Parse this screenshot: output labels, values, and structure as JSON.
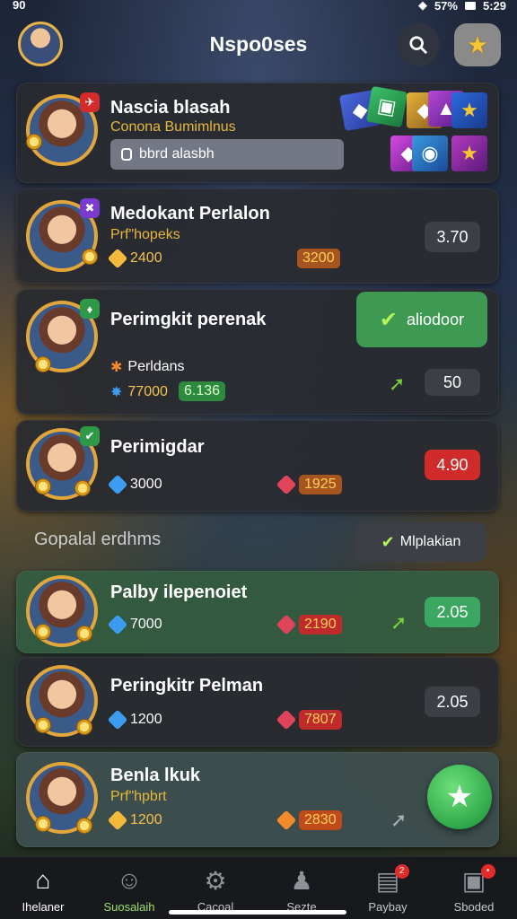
{
  "status": {
    "left": "90",
    "battery": "57%",
    "time": "5:29"
  },
  "header": {
    "title": "Nspo0ses",
    "search_icon": "search-icon",
    "star_icon": "star-icon",
    "star_glyph": "★"
  },
  "profile": {
    "name": "Nascia blasah",
    "subtitle": "Conona Bumimlnus",
    "field_value": "bbrd alasbh",
    "badge": "✈"
  },
  "cards": [
    {
      "name": "Medokant Perlalon",
      "sub": "Prf\"hopeks",
      "stat1": "2400",
      "stat2": "3200",
      "price": "3.70",
      "badge": "✖"
    },
    {
      "name": "Perimgkit perenak",
      "sub": "Perldans",
      "stat1": "77000",
      "stat2": "6.136",
      "price": "50",
      "action": "aliodoor",
      "badge": "♦"
    },
    {
      "name": "Perimigdar",
      "stat1": "3000",
      "stat2": "1925",
      "price": "4.90",
      "badge": "✔"
    },
    {
      "name": "Palby ilepenoiet",
      "stat1": "7000",
      "stat2": "2190",
      "price": "2.05"
    },
    {
      "name": "Peringkitr Pelman",
      "stat1": "1200",
      "stat2": "7807",
      "price": "2.05"
    },
    {
      "name": "Benla lkuk",
      "sub": "Prf\"hpbrt",
      "stat1": "1200",
      "stat2": "2830"
    }
  ],
  "section": {
    "label": "Gopalal erdhms",
    "button": "Mlplakian"
  },
  "nav": [
    {
      "label": "Ihelaner",
      "icon": "home-icon",
      "glyph": "⌂"
    },
    {
      "label": "Suosalaih",
      "icon": "group-icon",
      "glyph": "☺"
    },
    {
      "label": "Cacoal",
      "icon": "gear-icon",
      "glyph": "⚙"
    },
    {
      "label": "Sezte",
      "icon": "people-icon",
      "glyph": "♟"
    },
    {
      "label": "Paybay",
      "icon": "card-icon",
      "glyph": "▤",
      "badge": "2"
    },
    {
      "label": "Sboded",
      "icon": "gift-icon",
      "glyph": "▣",
      "badge": "•"
    }
  ],
  "colors": {
    "accent_green": "#3ba760",
    "accent_red": "#d12a2a",
    "gold": "#e9b838"
  }
}
